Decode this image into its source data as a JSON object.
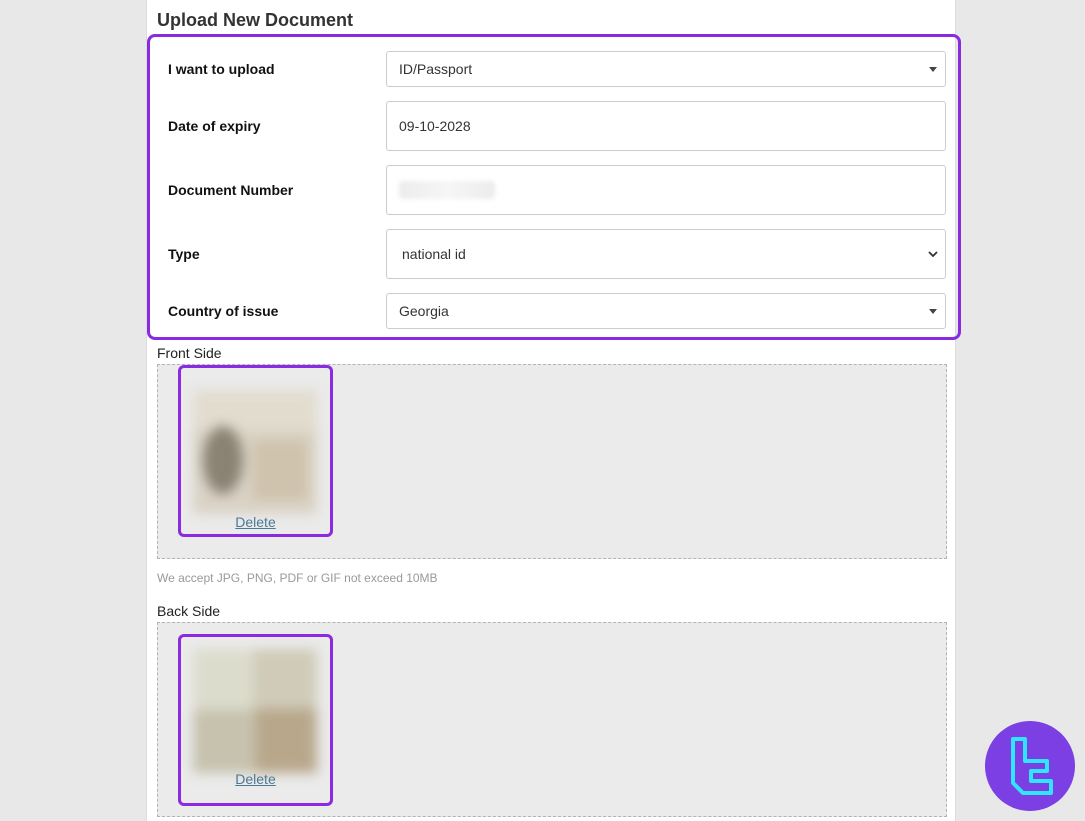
{
  "page": {
    "title": "Upload New Document"
  },
  "form": {
    "upload_type": {
      "label": "I want to upload",
      "value": "ID/Passport"
    },
    "expiry": {
      "label": "Date of expiry",
      "value": "09-10-2028"
    },
    "doc_number": {
      "label": "Document Number",
      "value": ""
    },
    "type": {
      "label": "Type",
      "value": "national id"
    },
    "country": {
      "label": "Country of issue",
      "value": "Georgia"
    }
  },
  "front": {
    "label": "Front Side",
    "delete_label": "Delete"
  },
  "hint": "We accept JPG, PNG, PDF or GIF not exceed 10MB",
  "back": {
    "label": "Back Side",
    "delete_label": "Delete"
  },
  "colors": {
    "highlight": "#8a2be2",
    "logo_bg": "#7b3fe4",
    "logo_fg": "#2ee6ff",
    "link": "#4a7a98"
  },
  "icons": {
    "dropdown": "caret-down-icon",
    "select": "chevron-down-icon",
    "brand": "brand-logo-icon"
  }
}
